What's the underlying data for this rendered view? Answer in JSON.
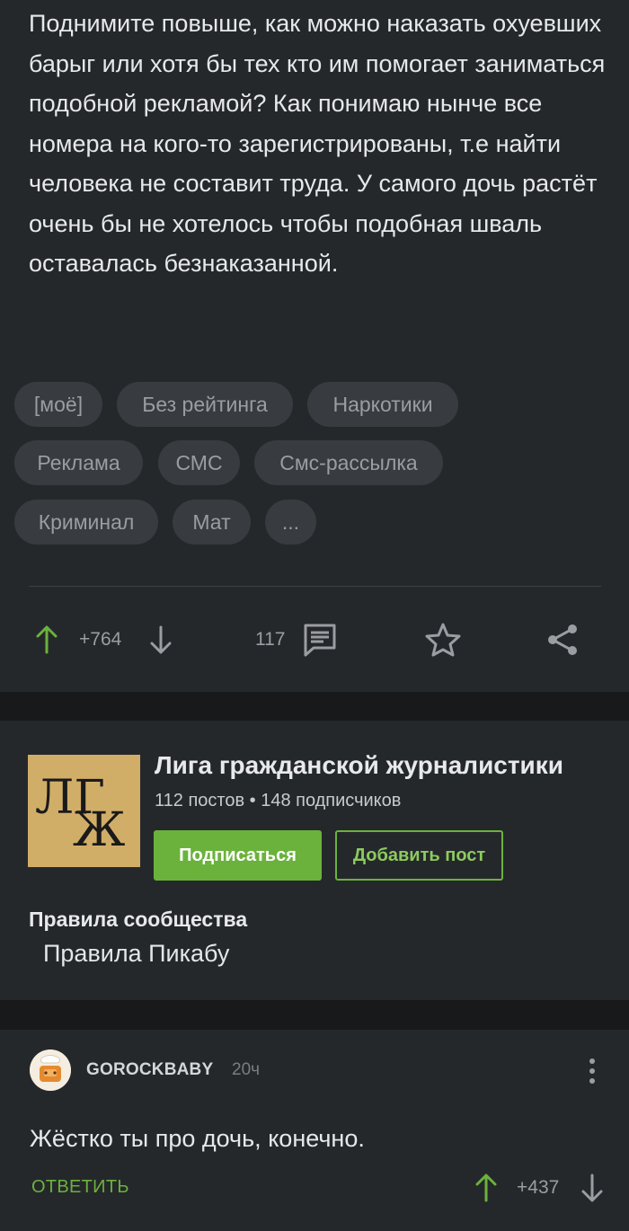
{
  "post": {
    "text": "Поднимите повыше, как можно наказать охуевших барыг или хотя бы тех кто им помогает заниматься подобной рекламой? Как понимаю нынче все номера на кого-то зарегистрированы, т.е найти человека не составит труда. У самого дочь растёт очень бы не хотелось чтобы подобная шваль оставалась безнаказанной.",
    "tags": [
      "[моё]",
      "Без рейтинга",
      "Наркотики",
      "Реклама",
      "СМС",
      "Смс-рассылка",
      "Криминал",
      "Мат",
      "..."
    ],
    "rating": "+764",
    "comments_count": "117"
  },
  "community": {
    "logo_line1": "ЛГ",
    "logo_line2": "Ж",
    "name": "Лига гражданской журналистики",
    "stats": "112 постов • 148 подписчиков",
    "subscribe_label": "Подписаться",
    "add_post_label": "Добавить пост",
    "rules_title": "Правила сообщества",
    "rules_link": "Правила Пикабу"
  },
  "comment": {
    "username": "GOROCKBABY",
    "time": "20ч",
    "text": "Жёстко ты про дочь, конечно.",
    "reply_label": "ОТВЕТИТЬ",
    "rating": "+437"
  },
  "colors": {
    "accent_green": "#6bb23d",
    "background": "#17191b",
    "card": "#25282b",
    "tag_bg": "#383b3f"
  },
  "icons": {
    "upvote": "arrow-up-icon",
    "downvote": "arrow-down-icon",
    "comments": "comment-icon",
    "save": "star-icon",
    "share": "share-icon",
    "more": "more-vertical-icon"
  }
}
